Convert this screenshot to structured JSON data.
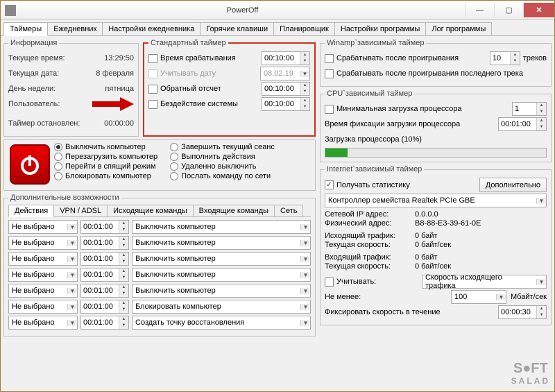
{
  "window": {
    "title": "PowerOff"
  },
  "mainTabs": [
    "Таймеры",
    "Ежедневник",
    "Настройки ежедневника",
    "Горячие клавиши",
    "Планировщик",
    "Настройки программы",
    "Лог программы"
  ],
  "mainTabActive": 0,
  "info": {
    "legend": "Информация",
    "l_time": "Текущее время:",
    "v_time": "13:29:50",
    "l_date": "Текущая дата:",
    "v_date": "8 февраля",
    "l_day": "День недели:",
    "v_day": "пятница",
    "l_user": "Пользователь:",
    "v_user": "------",
    "l_stopped": "Таймер остановлен:",
    "v_stopped": "00:00:00"
  },
  "std": {
    "legend": "Стандартный таймер",
    "c1": "Время срабатывания",
    "v1": "00:10:00",
    "c2": "Учитывать дату",
    "v2": "08.02.19",
    "c3": "Обратный отсчет",
    "v3": "00:10:00",
    "c4": "Бездействие системы",
    "v4": "00:10:00"
  },
  "radios": {
    "left": [
      "Выключить компьютер",
      "Перезагрузить компьютер",
      "Перейти в спящий режим",
      "Блокировать компьютер"
    ],
    "right": [
      "Завершить текущий сеанс",
      "Выполнить действия",
      "Удаленно выключить",
      "Послать команду по сети"
    ]
  },
  "extra": {
    "legend": "Дополнительные возможности",
    "tabs": [
      "Действия",
      "VPN / ADSL",
      "Исходящие команды",
      "Входящие команды",
      "Сеть"
    ],
    "tabActive": 0,
    "rows": [
      {
        "a": "Не выбрано",
        "t": "00:01:00",
        "b": "Выключить компьютер"
      },
      {
        "a": "Не выбрано",
        "t": "00:01:00",
        "b": "Выключить компьютер"
      },
      {
        "a": "Не выбрано",
        "t": "00:01:00",
        "b": "Выключить компьютер"
      },
      {
        "a": "Не выбрано",
        "t": "00:01:00",
        "b": "Выключить компьютер"
      },
      {
        "a": "Не выбрано",
        "t": "00:01:00",
        "b": "Выключить компьютер"
      },
      {
        "a": "Не выбрано",
        "t": "00:01:00",
        "b": "Блокировать компьютер"
      },
      {
        "a": "Не выбрано",
        "t": "00:01:00",
        "b": "Создать точку восстановления"
      }
    ]
  },
  "winamp": {
    "legend": "Winamp`зависимый таймер",
    "c1": "Срабатывать после проигрывания",
    "n": "10",
    "tracks": "треков",
    "c2": "Срабатывать после проигрывания последнего трека"
  },
  "cpu": {
    "legend": "CPU`зависимый таймер",
    "c1": "Минимальная загрузка процессора",
    "v1": "1",
    "l_fix": "Время фиксации загрузки процессора",
    "v_fix": "00:01:00",
    "l_load": "Загрузка процессора (10%)",
    "load_pct": 10
  },
  "net": {
    "legend": "Internet`зависимый таймер",
    "c_stat": "Получать статистику",
    "btn_more": "Дополнительно",
    "adapter": "Контроллер семейства Realtek PCIe GBE",
    "rows": [
      {
        "k": "Сетевой IP адрес:",
        "v": "0.0.0.0"
      },
      {
        "k": "Физический адрес:",
        "v": "B8-88-E3-39-61-0E"
      },
      {
        "k": "Исходящий трафик:",
        "v": "0 байт"
      },
      {
        "k": "Текущая скорость:",
        "v": "0 байт/сек"
      },
      {
        "k": "Входящий трафик:",
        "v": "0 байт"
      },
      {
        "k": "Текущая скорость:",
        "v": "0 байт/сек"
      }
    ],
    "c_consider": "Учитывать:",
    "consider_val": "Скорость исходящего трафика",
    "l_min": "Не менее:",
    "v_min": "100",
    "u_min": "Мбайт/сек",
    "l_fix": "Фиксировать скорость в течение",
    "v_fix": "00:00:30"
  }
}
